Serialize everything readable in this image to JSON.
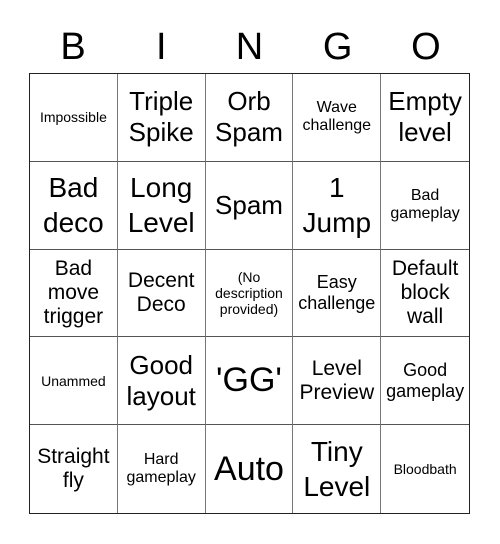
{
  "header": [
    "B",
    "I",
    "N",
    "G",
    "O"
  ],
  "cells": [
    {
      "text": "Impossible",
      "size": "s1"
    },
    {
      "text": "Triple Spike",
      "size": "s5"
    },
    {
      "text": "Orb Spam",
      "size": "s5"
    },
    {
      "text": "Wave challenge",
      "size": "s2"
    },
    {
      "text": "Empty level",
      "size": "s5"
    },
    {
      "text": "Bad deco",
      "size": "s6"
    },
    {
      "text": "Long Level",
      "size": "s6"
    },
    {
      "text": "Spam",
      "size": "s5"
    },
    {
      "text": "1 Jump",
      "size": "s6"
    },
    {
      "text": "Bad gameplay",
      "size": "s2"
    },
    {
      "text": "Bad move trigger",
      "size": "s4"
    },
    {
      "text": "Decent Deco",
      "size": "s4"
    },
    {
      "text": "(No description provided)",
      "size": "s1"
    },
    {
      "text": "Easy challenge",
      "size": "s3"
    },
    {
      "text": "Default block wall",
      "size": "s4"
    },
    {
      "text": "Unammed",
      "size": "s1"
    },
    {
      "text": "Good layout",
      "size": "s5"
    },
    {
      "text": "'GG'",
      "size": "s7"
    },
    {
      "text": "Level Preview",
      "size": "s4"
    },
    {
      "text": "Good gameplay",
      "size": "s3"
    },
    {
      "text": "Straight fly",
      "size": "s4"
    },
    {
      "text": "Hard gameplay",
      "size": "s2"
    },
    {
      "text": "Auto",
      "size": "s7"
    },
    {
      "text": "Tiny Level",
      "size": "s6"
    },
    {
      "text": "Bloodbath",
      "size": "s1"
    }
  ]
}
